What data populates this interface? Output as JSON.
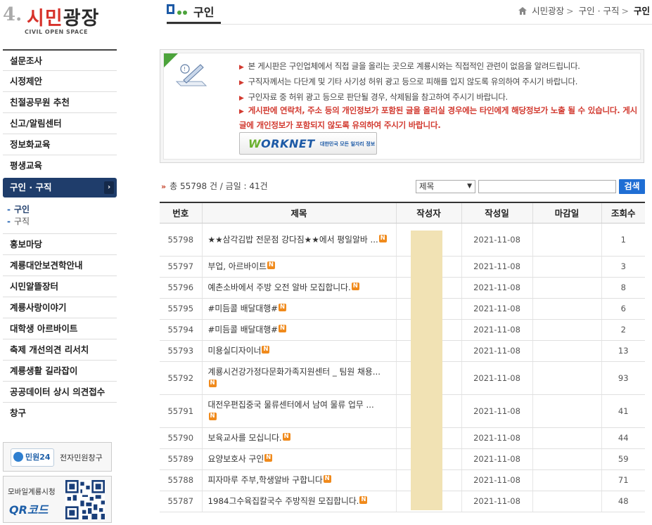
{
  "logo": {
    "number": "4.",
    "title_part1": "시민",
    "title_part2": "광장",
    "subtitle": "CIVIL OPEN SPACE"
  },
  "sidebar": {
    "items_top": [
      {
        "label": "설문조사"
      },
      {
        "label": "시정제안"
      },
      {
        "label": "친절공무원 추천"
      },
      {
        "label": "신고/알림센터"
      },
      {
        "label": "정보화교육"
      },
      {
        "label": "평생교육"
      }
    ],
    "active_item": {
      "label": "구인 · 구직",
      "arrow": "›"
    },
    "subitems": [
      {
        "label": "구인",
        "selected": true
      },
      {
        "label": "구직",
        "selected": false
      }
    ],
    "items_bottom": [
      {
        "label": "홍보마당"
      },
      {
        "label": "계룡대안보견학안내"
      },
      {
        "label": "시민알뜰장터"
      },
      {
        "label": "계룡사랑이야기"
      },
      {
        "label": "대학생 아르바이트"
      },
      {
        "label": "축제 개선의견 리서치"
      },
      {
        "label": "계룡생활 길라잡이"
      },
      {
        "label": "공공데이터 상시 의견접수"
      },
      {
        "label": "창구"
      }
    ],
    "banner_minwon": {
      "logo_text": "민원24",
      "label": "전자민원창구"
    },
    "banner_qr": {
      "label1": "모바일계룡시청",
      "label2": "QR코드"
    }
  },
  "header": {
    "title": "구인",
    "breadcrumb": [
      "시민광장",
      "구인 · 구직",
      "구인"
    ]
  },
  "notice": {
    "items": [
      "본 게시판은 구인업체에서 직접 글을 올리는 곳으로 계룡시와는 직접적인 관련이 없음을 알려드립니다.",
      "구직자께서는 다단계 및 기타 사기성 허위 광고 등으로 피해를 입지 않도록 유의하여 주시기 바랍니다.",
      "구인자료 중 허위 광고 등으로 판단될 경우, 삭제됨을 참고하여 주시기 바랍니다."
    ],
    "warning": "게시판에 연락처, 주소 등의 개인정보가 포함된 글을 올리실 경우에는 타인에게 해당정보가 노출 될 수 있습니다. 게시글에 개인정보가 포함되지 않도록 유의하여 주시기 바랍니다.",
    "worknet_logo": "ORKNET",
    "worknet_logo_w": "W",
    "worknet_sub": "대한민국 모든 일자리 정보"
  },
  "list_info": {
    "mark": "»",
    "text": "총 55798 건 / 금일 : 41건"
  },
  "search": {
    "select_value": "제목",
    "input_value": "",
    "button_label": "검색"
  },
  "table": {
    "headers": [
      "번호",
      "제목",
      "작성자",
      "작성일",
      "마감일",
      "조회수"
    ],
    "new_badge": "N",
    "rows": [
      {
        "no": "55798",
        "title": "★★삼각김밥 전문점 강다짐★★에서 평일알바 ...",
        "author": "",
        "date": "2021-11-08",
        "deadline": "",
        "views": "1"
      },
      {
        "no": "55797",
        "title": "부업, 아르바이트",
        "author": "",
        "date": "2021-11-08",
        "deadline": "",
        "views": "3"
      },
      {
        "no": "55796",
        "title": "예촌소바에서 주방 오전 알바 모집합니다.",
        "author": "",
        "date": "2021-11-08",
        "deadline": "",
        "views": "8"
      },
      {
        "no": "55795",
        "title": "#미듬콜 배달대행#",
        "author": "",
        "date": "2021-11-08",
        "deadline": "",
        "views": "6"
      },
      {
        "no": "55794",
        "title": "#미듬콜 배달대행#",
        "author": "",
        "date": "2021-11-08",
        "deadline": "",
        "views": "2"
      },
      {
        "no": "55793",
        "title": "미용실디자이너",
        "author": "",
        "date": "2021-11-08",
        "deadline": "",
        "views": "13"
      },
      {
        "no": "55792",
        "title": "계룡시건강가정다문화가족지원센터 _ 팀원 채용...",
        "author": "",
        "date": "2021-11-08",
        "deadline": "",
        "views": "93"
      },
      {
        "no": "55791",
        "title": "대전우편집중국 물류센터에서 남여 물류 업무 ...",
        "author": "",
        "date": "2021-11-08",
        "deadline": "",
        "views": "41"
      },
      {
        "no": "55790",
        "title": "보육교사를 모십니다.",
        "author": "",
        "date": "2021-11-08",
        "deadline": "",
        "views": "44"
      },
      {
        "no": "55789",
        "title": "요양보호사 구인",
        "author": "",
        "date": "2021-11-08",
        "deadline": "",
        "views": "59"
      },
      {
        "no": "55788",
        "title": "피자마루 주부,학생알바 구합니다",
        "author": "",
        "date": "2021-11-08",
        "deadline": "",
        "views": "71"
      },
      {
        "no": "55787",
        "title": "1984그수육집칼국수 주방직원 모집합니다.",
        "author": "",
        "date": "2021-11-08",
        "deadline": "",
        "views": "48"
      }
    ]
  },
  "colors": {
    "accent_navy": "#1f3d6b",
    "search_blue": "#1f6ed4",
    "warning_red": "#d23a30",
    "new_badge": "#f08a1c",
    "redacted": "#f1e2b4"
  }
}
